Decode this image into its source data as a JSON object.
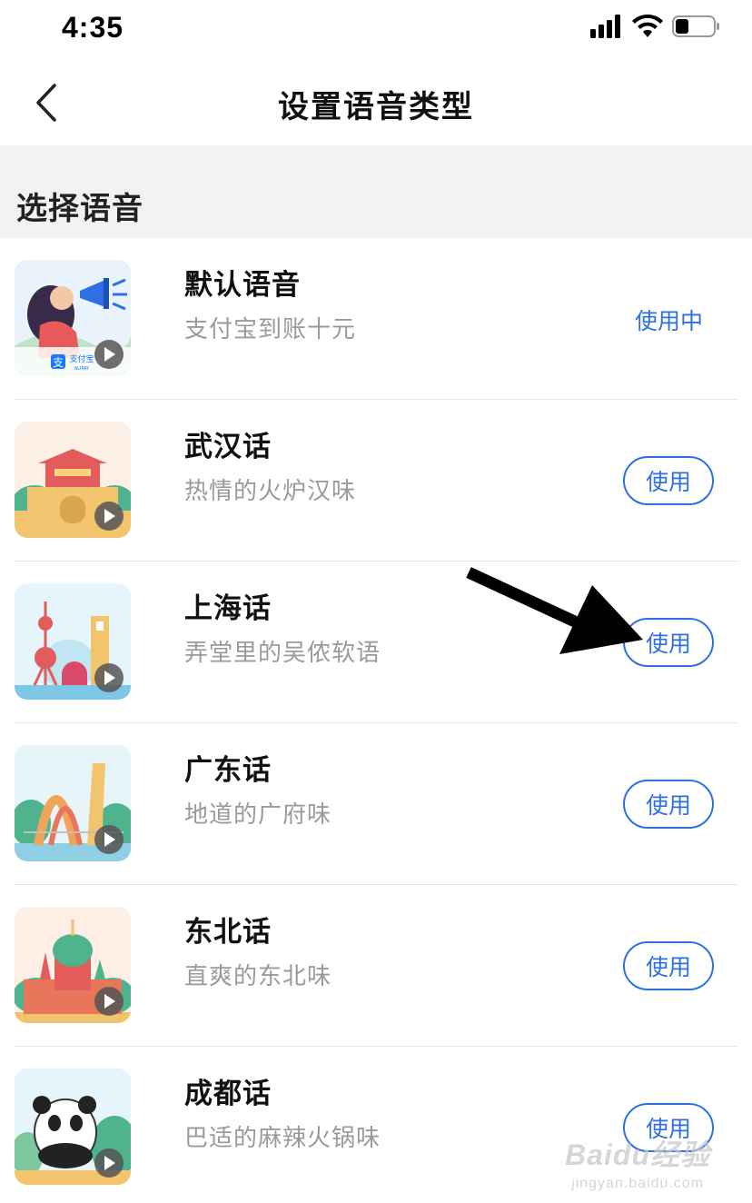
{
  "status_bar": {
    "time": "4:35",
    "icons": [
      "signal-icon",
      "wifi-icon",
      "battery-icon"
    ]
  },
  "nav": {
    "title": "设置语音类型",
    "back_icon": "chevron-left-icon"
  },
  "section": {
    "title": "选择语音"
  },
  "voices": [
    {
      "name": "默认语音",
      "desc": "支付宝到账十元",
      "action": "使用中",
      "in_use": true,
      "thumb_text": "支付宝",
      "thumb_subtext": "ALIPAY"
    },
    {
      "name": "武汉话",
      "desc": "热情的火炉汉味",
      "action": "使用",
      "in_use": false
    },
    {
      "name": "上海话",
      "desc": "弄堂里的吴侬软语",
      "action": "使用",
      "in_use": false
    },
    {
      "name": "广东话",
      "desc": "地道的广府味",
      "action": "使用",
      "in_use": false
    },
    {
      "name": "东北话",
      "desc": "直爽的东北味",
      "action": "使用",
      "in_use": false
    },
    {
      "name": "成都话",
      "desc": "巴适的麻辣火锅味",
      "action": "使用",
      "in_use": false
    }
  ],
  "watermark": {
    "main": "Baidu经验",
    "sub": "jingyan.baidu.com"
  },
  "colors": {
    "accent": "#2f6fe4",
    "section_bg": "#f2f2f2",
    "desc_text": "#9a9a9a"
  }
}
